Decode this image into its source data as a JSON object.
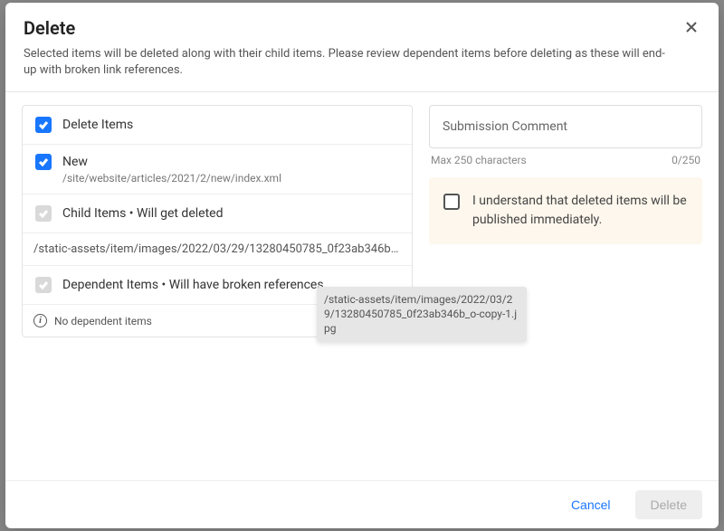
{
  "header": {
    "title": "Delete",
    "description": "Selected items will be deleted along with their child items. Please review dependent items before deleting as these will end-up with broken link references."
  },
  "left": {
    "delete_items_label": "Delete Items",
    "new_item": {
      "label": "New",
      "path": "/site/website/articles/2021/2/new/index.xml"
    },
    "child_items_label": "Child Items • Will get deleted",
    "child_item_path": "/static-assets/item/images/2022/03/29/13280450785_0f23ab346b_o-copy-1.j…",
    "dependent_items_label": "Dependent Items • Will have broken references",
    "no_dependent_text": "No dependent items"
  },
  "right": {
    "comment_placeholder": "Submission Comment",
    "max_label": "Max 250 characters",
    "counter": "0/250",
    "confirm_text": "I understand that deleted items will be published immediately."
  },
  "tooltip": {
    "text": "/static-assets/item/images/2022/03/29/13280450785_0f23ab346b_o-copy-1.jpg"
  },
  "footer": {
    "cancel": "Cancel",
    "delete": "Delete"
  }
}
